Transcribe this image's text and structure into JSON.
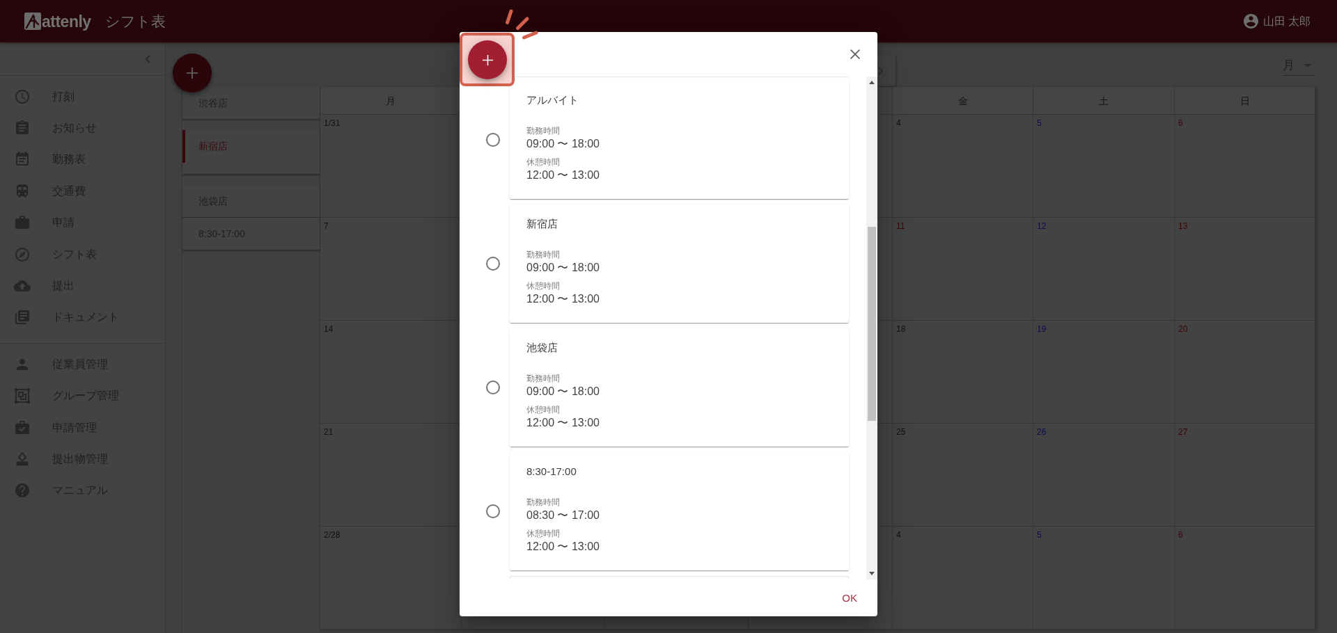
{
  "app_bar": {
    "logo_text": "attenly",
    "title": "シフト表",
    "user_name": "山田 太郎"
  },
  "sidebar": {
    "groups": [
      {
        "items": [
          {
            "label": "打刻"
          },
          {
            "label": "お知らせ"
          },
          {
            "label": "勤務表"
          },
          {
            "label": "交通費"
          },
          {
            "label": "申請"
          },
          {
            "label": "シフト表"
          },
          {
            "label": "提出"
          },
          {
            "label": "ドキュメント"
          }
        ]
      },
      {
        "items": [
          {
            "label": "従業員管理"
          },
          {
            "label": "グループ管理"
          },
          {
            "label": "申請管理"
          },
          {
            "label": "提出物管理"
          },
          {
            "label": "マニュアル"
          }
        ]
      }
    ]
  },
  "shift_groups": {
    "items": [
      {
        "label": "渋谷店",
        "selected": false
      },
      {
        "label": "新宿店",
        "selected": true
      },
      {
        "label": "池袋店",
        "selected": false
      },
      {
        "label": "8:30-17:00",
        "selected": false
      }
    ]
  },
  "calendar": {
    "view": "月",
    "left_columns": [
      {
        "weekday": "月",
        "days": [
          {
            "date": "1/31",
            "kind": "weekday"
          },
          {
            "date": "7",
            "kind": "weekday"
          },
          {
            "date": "14",
            "kind": "weekday"
          },
          {
            "date": "21",
            "kind": "weekday"
          },
          {
            "date": "2/28",
            "kind": "weekday"
          }
        ]
      }
    ],
    "right_columns": [
      {
        "weekday": "金",
        "days": [
          {
            "date": "4",
            "kind": "weekday"
          },
          {
            "date": "11",
            "kind": "holiday"
          },
          {
            "date": "18",
            "kind": "weekday"
          },
          {
            "date": "25",
            "kind": "weekday"
          },
          {
            "date": "4",
            "kind": "weekday"
          }
        ]
      },
      {
        "weekday": "土",
        "days": [
          {
            "date": "5",
            "kind": "saturday"
          },
          {
            "date": "12",
            "kind": "saturday"
          },
          {
            "date": "19",
            "kind": "saturday"
          },
          {
            "date": "26",
            "kind": "saturday"
          },
          {
            "date": "5",
            "kind": "saturday"
          }
        ]
      },
      {
        "weekday": "日",
        "days": [
          {
            "date": "6",
            "kind": "sunday"
          },
          {
            "date": "13",
            "kind": "sunday"
          },
          {
            "date": "20",
            "kind": "sunday"
          },
          {
            "date": "27",
            "kind": "sunday"
          },
          {
            "date": "6",
            "kind": "sunday"
          }
        ]
      }
    ]
  },
  "dialog": {
    "add_button": {
      "highlighted": true
    },
    "options": [
      {
        "title": "アルバイト",
        "work_label": "勤務時間",
        "work_time": "09:00 〜 18:00",
        "break_label": "休憩時間",
        "break_time": "12:00 〜 13:00",
        "selected": false
      },
      {
        "title": "新宿店",
        "work_label": "勤務時間",
        "work_time": "09:00 〜 18:00",
        "break_label": "休憩時間",
        "break_time": "12:00 〜 13:00",
        "selected": false
      },
      {
        "title": "池袋店",
        "work_label": "勤務時間",
        "work_time": "09:00 〜 18:00",
        "break_label": "休憩時間",
        "break_time": "12:00 〜 13:00",
        "selected": false
      },
      {
        "title": "8:30-17:00",
        "work_label": "勤務時間",
        "work_time": "08:30 〜 17:00",
        "break_label": "休憩時間",
        "break_time": "12:00 〜 13:00",
        "selected": false
      }
    ],
    "more_below": true,
    "ok_label": "OK"
  }
}
